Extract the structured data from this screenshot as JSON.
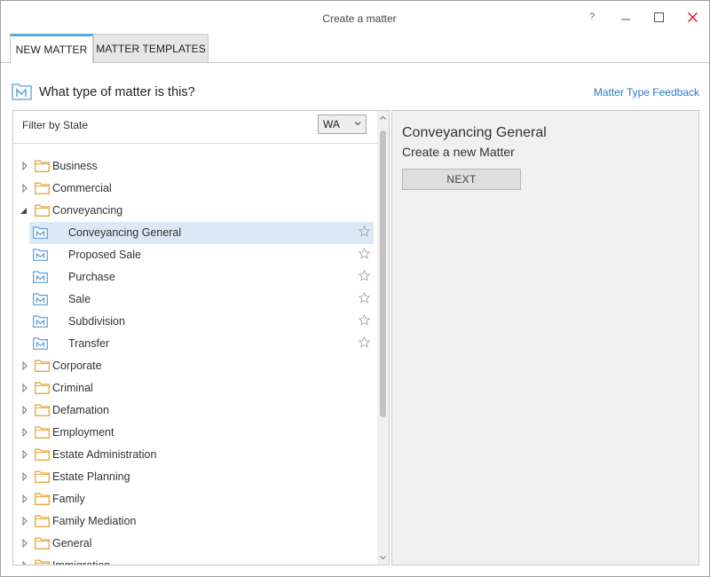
{
  "window": {
    "title": "Create a matter",
    "help_glyph": "?"
  },
  "tabs": [
    {
      "label": "NEW MATTER",
      "active": true
    },
    {
      "label": "MATTER TEMPLATES",
      "active": false
    }
  ],
  "header": {
    "question": "What type of matter is this?",
    "feedback_link": "Matter Type Feedback"
  },
  "filter": {
    "label": "Filter by State",
    "selected_state": "WA"
  },
  "tree": [
    {
      "label": "Business",
      "level": 0,
      "kind": "folder",
      "expanded": false
    },
    {
      "label": "Commercial",
      "level": 0,
      "kind": "folder",
      "expanded": false
    },
    {
      "label": "Conveyancing",
      "level": 0,
      "kind": "folder",
      "expanded": true
    },
    {
      "label": "Conveyancing General",
      "level": 1,
      "kind": "matter-type",
      "selected": true
    },
    {
      "label": "Proposed Sale",
      "level": 1,
      "kind": "matter-type"
    },
    {
      "label": "Purchase",
      "level": 1,
      "kind": "matter-type"
    },
    {
      "label": "Sale",
      "level": 1,
      "kind": "matter-type"
    },
    {
      "label": "Subdivision",
      "level": 1,
      "kind": "matter-type"
    },
    {
      "label": "Transfer",
      "level": 1,
      "kind": "matter-type"
    },
    {
      "label": "Corporate",
      "level": 0,
      "kind": "folder",
      "expanded": false
    },
    {
      "label": "Criminal",
      "level": 0,
      "kind": "folder",
      "expanded": false
    },
    {
      "label": "Defamation",
      "level": 0,
      "kind": "folder",
      "expanded": false
    },
    {
      "label": "Employment",
      "level": 0,
      "kind": "folder",
      "expanded": false
    },
    {
      "label": "Estate Administration",
      "level": 0,
      "kind": "folder",
      "expanded": false
    },
    {
      "label": "Estate Planning",
      "level": 0,
      "kind": "folder",
      "expanded": false
    },
    {
      "label": "Family",
      "level": 0,
      "kind": "folder",
      "expanded": false
    },
    {
      "label": "Family Mediation",
      "level": 0,
      "kind": "folder",
      "expanded": false
    },
    {
      "label": "General",
      "level": 0,
      "kind": "folder",
      "expanded": false
    },
    {
      "label": "Immigration",
      "level": 0,
      "kind": "folder",
      "expanded": false
    }
  ],
  "detail": {
    "title": "Conveyancing General",
    "subtitle": "Create a new Matter",
    "next_label": "NEXT"
  },
  "colors": {
    "accent": "#5aa7de",
    "link": "#2a7bc4",
    "folder": "#e8a93a",
    "matter_icon": "#5a9fd6",
    "selected_row": "#dbe9f7",
    "close_x": "#d9232d"
  }
}
